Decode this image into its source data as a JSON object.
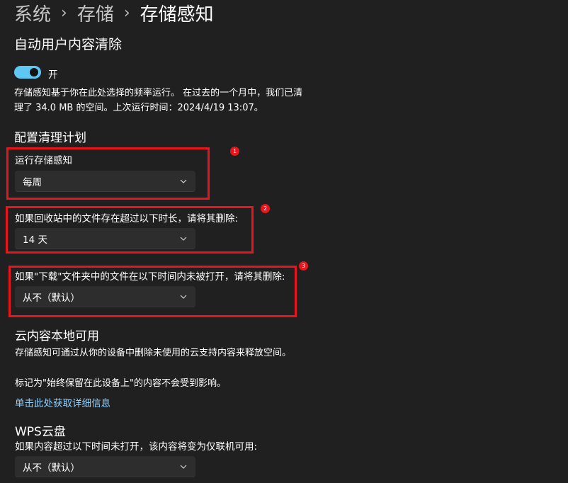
{
  "breadcrumb": [
    "系统",
    "存储",
    "存储感知"
  ],
  "auto_cleanup": {
    "title": "自动用户内容清除",
    "toggle_label": "开",
    "description": "存储感知基于你在此处选择的频率运行。 在过去的一个月中，我们已清理了 34.0 MB 的空间。上次运行时间：2024/4/19 13:07。"
  },
  "schedule": {
    "title": "配置清理计划",
    "run_label": "运行存储感知",
    "run_value": "每周",
    "recycle_label": "如果回收站中的文件存在超过以下时长，请将其删除:",
    "recycle_value": "14 天",
    "downloads_label": "如果\"下载\"文件夹中的文件在以下时间内未被打开，请将其删除:",
    "downloads_value": "从不（默认）"
  },
  "cloud": {
    "title": "云内容本地可用",
    "desc1": "存储感知可通过从你的设备中删除未使用的云支持内容来释放空间。",
    "desc2": "标记为\"始终保留在此设备上\"的内容不会受到影响。",
    "link": "单击此处获取详细信息"
  },
  "wps": {
    "title": "WPS云盘",
    "label": "如果内容超过以下时间未打开，该内容将变为仅联机可用:",
    "value": "从不（默认）"
  },
  "annotations": [
    "1",
    "2",
    "3"
  ],
  "colors": {
    "background": "#202020",
    "accent": "#5ec8f5",
    "link": "#8fd0ff",
    "annotation_red": "#e8161c",
    "dropdown_bg": "#2d2d2d"
  },
  "icons": {
    "separator": "chevron-right-icon",
    "dropdown": "chevron-down-icon"
  }
}
